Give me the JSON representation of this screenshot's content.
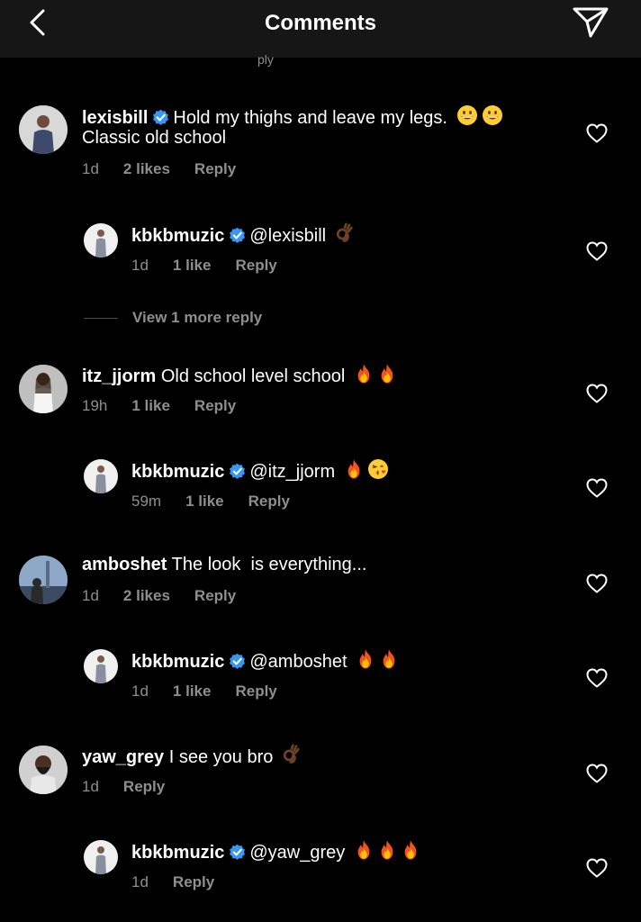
{
  "header": {
    "title": "Comments",
    "cut_fragment": "ply"
  },
  "comments": [
    {
      "username": "lexisbill",
      "verified": true,
      "text": "Hold my thighs and leave my legs.",
      "text_line2": "Classic old school",
      "emojis": [
        "grinning",
        "grinning"
      ],
      "time": "1d",
      "likes": "2 likes",
      "reply": "Reply"
    },
    {
      "username": "kbkbmuzic",
      "verified": true,
      "text": "@lexisbill",
      "emojis": [
        "ok-hand"
      ],
      "time": "1d",
      "likes": "1 like",
      "reply": "Reply"
    },
    {
      "username": "itz_jjorm",
      "verified": false,
      "text": "Old school level school",
      "emojis": [
        "fire",
        "fire"
      ],
      "time": "19h",
      "likes": "1 like",
      "reply": "Reply"
    },
    {
      "username": "kbkbmuzic",
      "verified": true,
      "text": "@itz_jjorm",
      "emojis": [
        "fire",
        "kiss"
      ],
      "time": "59m",
      "likes": "1 like",
      "reply": "Reply"
    },
    {
      "username": "amboshet",
      "verified": false,
      "text": "The look  is everything...",
      "emojis": [],
      "time": "1d",
      "likes": "2 likes",
      "reply": "Reply"
    },
    {
      "username": "kbkbmuzic",
      "verified": true,
      "text": "@amboshet",
      "emojis": [
        "fire",
        "fire"
      ],
      "time": "1d",
      "likes": "1 like",
      "reply": "Reply"
    },
    {
      "username": "yaw_grey",
      "verified": false,
      "text": "I see you bro",
      "emojis": [
        "ok-hand"
      ],
      "time": "1d",
      "reply": "Reply"
    },
    {
      "username": "kbkbmuzic",
      "verified": true,
      "text": "@yaw_grey",
      "emojis": [
        "fire",
        "fire",
        "fire"
      ],
      "time": "1d",
      "reply": "Reply"
    }
  ],
  "view_more_replies": "View 1 more reply",
  "colors": {
    "background": "#000000",
    "header": "#161616",
    "secondary_text": "#8e8e8e",
    "verified": "#3897f0"
  }
}
